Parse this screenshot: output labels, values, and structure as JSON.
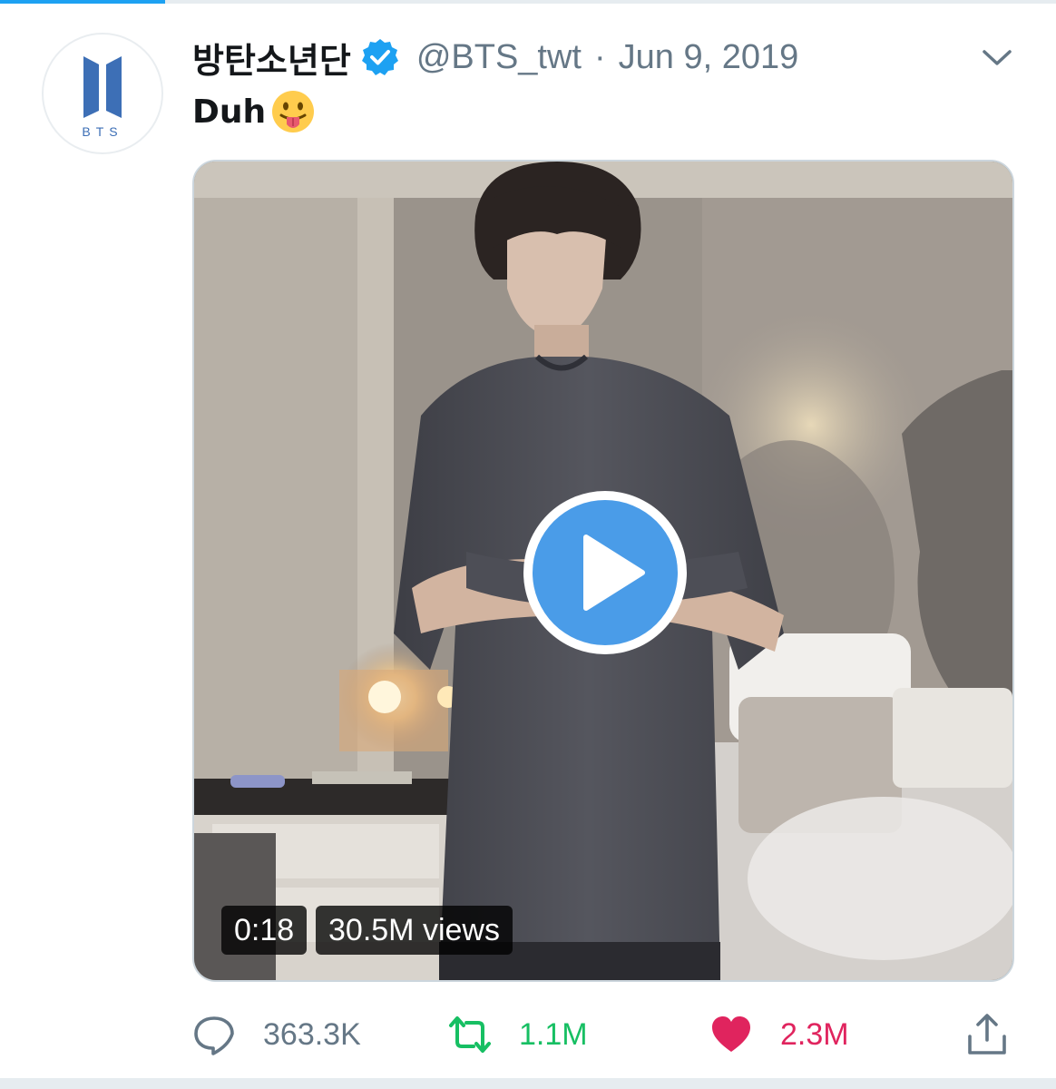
{
  "tweet": {
    "display_name": "방탄소년단",
    "handle": "@BTS_twt",
    "separator": "·",
    "date": "Jun 9, 2019",
    "text": "Duh",
    "emoji": "face-with-tongue",
    "avatar_text": "BTS"
  },
  "media": {
    "duration": "0:18",
    "views": "30.5M views"
  },
  "actions": {
    "replies": "363.3K",
    "retweets": "1.1M",
    "likes": "2.3M"
  },
  "colors": {
    "brand_blue": "#1da1f2",
    "avatar_logo": "#3d6fb6",
    "retweet_green": "#17bf63",
    "like_red": "#e0245e",
    "text_gray": "#657786",
    "play_blue": "#4a9ce8"
  }
}
